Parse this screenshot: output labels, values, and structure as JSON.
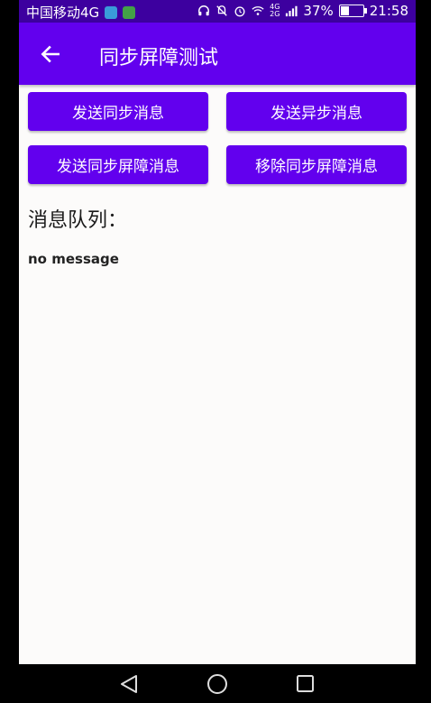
{
  "status_bar": {
    "carrier": "中国移动4G",
    "net_top": "4G",
    "net_bottom": "2G",
    "battery_percent": "37%",
    "battery_level": 0.37,
    "time": "21:58"
  },
  "app_bar": {
    "title": "同步屏障测试"
  },
  "buttons": {
    "send_sync": "发送同步消息",
    "send_async": "发送异步消息",
    "send_barrier": "发送同步屏障消息",
    "remove_barrier": "移除同步屏障消息"
  },
  "queue": {
    "title": "消息队列：",
    "message": "no message"
  },
  "colors": {
    "primary": "#6200ee",
    "primary_dark": "#3d009f"
  }
}
